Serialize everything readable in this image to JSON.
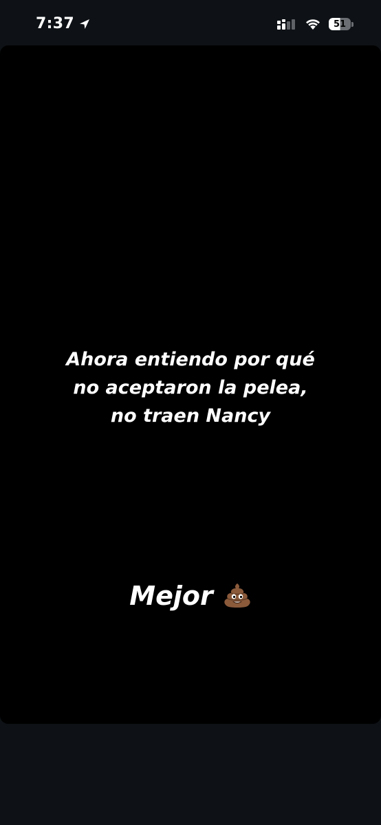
{
  "status_bar": {
    "time": "7:37",
    "battery_level": "51",
    "icons": [
      "location-arrow-icon",
      "cellular-signal-icon",
      "wifi-icon",
      "battery-icon"
    ]
  },
  "story": {
    "caption_lines": [
      "Ahora entiendo por qué",
      "no aceptaron la pelea,",
      "no traen Nancy"
    ],
    "secondary_text": "Mejor",
    "secondary_emoji": "pile-of-poo-icon"
  },
  "colors": {
    "background": "#0e1216",
    "card": "#000000",
    "text": "#ffffff"
  }
}
